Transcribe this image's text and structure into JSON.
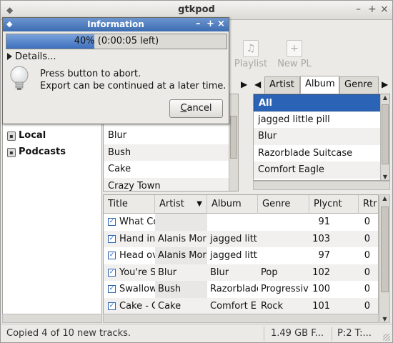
{
  "window": {
    "title": "gtkpod",
    "controls": [
      "–",
      "+",
      "×"
    ]
  },
  "toolbar": {
    "buttons": [
      {
        "label": "Playlist"
      },
      {
        "label": "New PL"
      }
    ]
  },
  "sidebar": {
    "items": [
      {
        "label": "Local"
      },
      {
        "label": "Podcasts"
      }
    ]
  },
  "sort_tabs": {
    "nav_left": "◀",
    "nav_right": "▶",
    "tabs": [
      "Artist",
      "Album",
      "Genre"
    ],
    "active_tab": "Album",
    "artist_list": [
      "Blur",
      "Bush",
      "Cake",
      "Crazy Town"
    ],
    "album_list": [
      "All",
      "jagged little pill",
      "Blur",
      "Razorblade Suitcase",
      "Comfort Eagle"
    ],
    "album_selected": "All"
  },
  "tracks": {
    "columns": [
      "Title",
      "Artist",
      "Album",
      "Genre",
      "Plycnt",
      "Rtr"
    ],
    "sorted_column": "Artist",
    "rows": [
      {
        "title": "What Co",
        "artist": "",
        "album": "",
        "genre": "",
        "plycnt": "91",
        "rtr": "0"
      },
      {
        "title": "Hand in",
        "artist": "Alanis Mor",
        "album": "jagged littl",
        "genre": "",
        "plycnt": "103",
        "rtr": "0"
      },
      {
        "title": "Head ov",
        "artist": "Alanis Mor",
        "album": "jagged littl",
        "genre": "",
        "plycnt": "97",
        "rtr": "0"
      },
      {
        "title": "You're S",
        "artist": "Blur",
        "album": "Blur",
        "genre": "Pop",
        "plycnt": "102",
        "rtr": "0"
      },
      {
        "title": "Swallow",
        "artist": "Bush",
        "album": "Razorblade",
        "genre": "Progressiv",
        "plycnt": "100",
        "rtr": "0"
      },
      {
        "title": "Cake - C",
        "artist": "Cake",
        "album": "Comfort E",
        "genre": "Rock",
        "plycnt": "101",
        "rtr": "0"
      }
    ]
  },
  "statusbar": {
    "message": "Copied 4 of 10 new tracks.",
    "free_space": "1.49 GB F...",
    "counts": "P:2 T:..."
  },
  "dialog": {
    "title": "Information",
    "controls": [
      "–",
      "+",
      "×"
    ],
    "progress_fraction": 0.4,
    "progress_text": "40% (0:00:05 left)",
    "details_label": "Details...",
    "message_line1": "Press button to abort.",
    "message_line2": "Export can be continued at a later time.",
    "cancel_label": "Cancel",
    "cancel_mnemonic": "C"
  },
  "icons": {
    "app": "gtkpod-app-icon",
    "bulb": "lightbulb-icon",
    "playlist": "playlist-icon",
    "new_pl": "new-playlist-icon",
    "ipod": "ipod-icon",
    "sort": "sort-descending-icon",
    "checkbox": "checkbox-checked-icon"
  },
  "colors": {
    "selection": "#2b63b7",
    "progress": "#3d6fbd",
    "dialog_title": "#4a7bbf",
    "window_bg": "#eceae6"
  }
}
